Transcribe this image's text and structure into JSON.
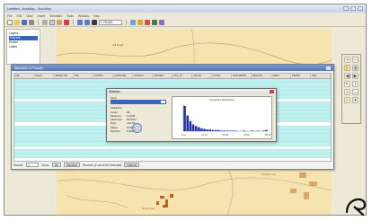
{
  "window": {
    "title": "Untitled - ArcMap - ArcView"
  },
  "menubar": [
    "File",
    "Edit",
    "View",
    "Insert",
    "Selection",
    "Tools",
    "Window",
    "Help"
  ],
  "toolbar": {
    "scale_value": "1:78,000",
    "icons": [
      "new-icon",
      "open-icon",
      "save-icon",
      "print-icon",
      "cut-icon",
      "copy-icon",
      "paste-icon",
      "delete-icon",
      "undo-icon",
      "redo-icon",
      "add-data-icon",
      "zoom-in-icon",
      "zoom-out-icon",
      "pan-icon",
      "full-extent-icon",
      "identify-icon",
      "find-icon"
    ]
  },
  "toc": {
    "items": [
      "Layers",
      "Parcels",
      "Roads",
      "Lakes"
    ]
  },
  "attribute_table": {
    "title": "Attributes of Parcels",
    "columns": [
      "FID",
      "Shape",
      "OBJECTID",
      "PIN",
      "ACRES",
      "LANDUSE",
      "ZONING",
      "OWNER",
      "TAX_ID",
      "VALUE",
      "TOTAL",
      "NEIGHBOR",
      "REGION",
      "AREA",
      "PERIM",
      "LEN"
    ],
    "row_count": 20,
    "status": {
      "record_label": "Record:",
      "record_value": "1",
      "show_label": "Show:",
      "all_button": "All",
      "selected_button": "Selected",
      "records_text": "Records (0 out of 68 Selected)",
      "options_button": "Options"
    }
  },
  "stats_dialog": {
    "title": "Statistics",
    "field_label": "Field",
    "field_value": "ACRES",
    "stats_label": "Statistics:",
    "stats": [
      {
        "k": "Count:",
        "v": "68"
      },
      {
        "k": "Minimum:",
        "v": "0.1234"
      },
      {
        "k": "Maximum:",
        "v": "58.5417"
      },
      {
        "k": "Sum:",
        "v": "412.33"
      },
      {
        "k": "Mean:",
        "v": "6.0637"
      },
      {
        "k": "Std Dev:",
        "v": "9.4318"
      }
    ]
  },
  "chart_data": {
    "type": "bar",
    "title": "Frequency Distribution",
    "categories": [
      "1",
      "2",
      "3",
      "4",
      "5",
      "6",
      "7",
      "8",
      "9",
      "10",
      "11",
      "12",
      "13",
      "14",
      "15",
      "16",
      "17",
      "18",
      "19",
      "20",
      "21",
      "22",
      "23",
      "24",
      "25",
      "26",
      "27",
      "28",
      "29",
      "30"
    ],
    "values": [
      45,
      28,
      18,
      12,
      9,
      7,
      5,
      4,
      3,
      3,
      2,
      2,
      2,
      1,
      1,
      1,
      1,
      1,
      1,
      0,
      0,
      1,
      0,
      0,
      1,
      0,
      1,
      0,
      1,
      2
    ],
    "ylim": [
      0,
      48
    ],
    "tick_labels": [
      "0.12",
      "14.72",
      "29.33",
      "43.93",
      "58.54"
    ]
  },
  "map": {
    "labels": [
      "Hill Road",
      "County Line",
      "North Fork"
    ]
  },
  "tools": [
    "zoom-in-icon",
    "zoom-out-icon",
    "pan-icon",
    "globe-icon",
    "back-icon",
    "forward-icon",
    "select-icon",
    "info-icon",
    "find-icon",
    "measure-icon",
    "hyperlink-icon",
    "flash-icon"
  ]
}
